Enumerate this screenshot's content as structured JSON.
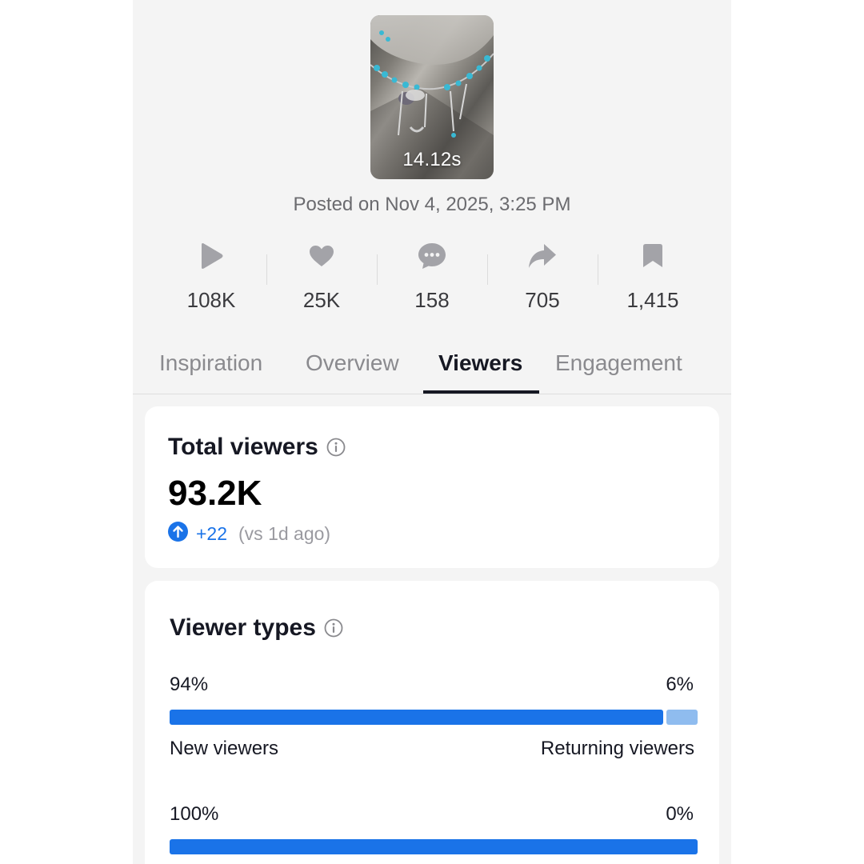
{
  "video": {
    "duration": "14.12s",
    "posted": "Posted on Nov 4, 2025, 3:25 PM"
  },
  "stats": [
    {
      "icon": "play-icon",
      "value": "108K"
    },
    {
      "icon": "heart-icon",
      "value": "25K"
    },
    {
      "icon": "comment-icon",
      "value": "158"
    },
    {
      "icon": "share-icon",
      "value": "705"
    },
    {
      "icon": "bookmark-icon",
      "value": "1,415"
    }
  ],
  "tabs": [
    {
      "label": "Inspiration",
      "active": false
    },
    {
      "label": "Overview",
      "active": false
    },
    {
      "label": "Viewers",
      "active": true
    },
    {
      "label": "Engagement",
      "active": false
    }
  ],
  "total_viewers": {
    "title": "Total viewers",
    "value": "93.2K",
    "delta": "+22",
    "delta_ref": "(vs 1d ago)"
  },
  "viewer_types": {
    "title": "Viewer types",
    "rows": [
      {
        "left_pct": "94%",
        "right_pct": "6%",
        "left_fraction": 0.94,
        "left_label": "New viewers",
        "right_label": "Returning viewers"
      },
      {
        "left_pct": "100%",
        "right_pct": "0%",
        "left_fraction": 1.0
      }
    ]
  },
  "colors": {
    "accent": "#1a73e8",
    "bar_primary": "#1a73e8",
    "bar_secondary": "#8fbcef",
    "icon_gray": "#a3a3a8",
    "background": "#f4f4f4"
  }
}
